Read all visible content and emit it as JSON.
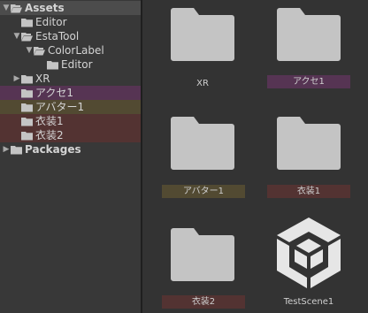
{
  "colors": {
    "tree_bg": "#383838",
    "grid_bg": "#333333",
    "label_purple": "#563453",
    "label_olive": "#524a32",
    "label_red": "#533332",
    "folder_gray": "#c4c4c4"
  },
  "tree": {
    "items": [
      {
        "label": "Assets",
        "expanded": true,
        "icon": "folder-open-icon",
        "bold": true,
        "selected": true
      },
      {
        "label": "Editor",
        "icon": "folder-icon"
      },
      {
        "label": "EstaTool",
        "expanded": true,
        "icon": "folder-open-icon"
      },
      {
        "label": "ColorLabel",
        "expanded": true,
        "icon": "folder-open-icon"
      },
      {
        "label": "Editor",
        "icon": "folder-icon"
      },
      {
        "label": "XR",
        "expanded": false,
        "icon": "folder-icon"
      },
      {
        "label": "アクセ1",
        "icon": "folder-icon",
        "highlight": "#563453"
      },
      {
        "label": "アバター1",
        "icon": "folder-icon",
        "highlight": "#524a32"
      },
      {
        "label": "衣装1",
        "icon": "folder-icon",
        "highlight": "#533332"
      },
      {
        "label": "衣装2",
        "icon": "folder-icon",
        "highlight": "#533332"
      },
      {
        "label": "Packages",
        "expanded": false,
        "icon": "folder-icon",
        "bold": true
      }
    ]
  },
  "grid": {
    "items": [
      {
        "label": "",
        "icon": "folder-icon"
      },
      {
        "label": "",
        "icon": "folder-icon"
      },
      {
        "label": "XR",
        "icon": "folder-icon"
      },
      {
        "label": "アクセ1",
        "icon": "folder-icon",
        "highlight": "#563453"
      },
      {
        "label": "アバター1",
        "icon": "folder-icon",
        "highlight": "#524a32"
      },
      {
        "label": "衣装1",
        "icon": "folder-icon",
        "highlight": "#533332"
      },
      {
        "label": "衣装2",
        "icon": "folder-icon",
        "highlight": "#533332"
      },
      {
        "label": "TestScene1",
        "icon": "unity-scene-icon"
      }
    ]
  }
}
